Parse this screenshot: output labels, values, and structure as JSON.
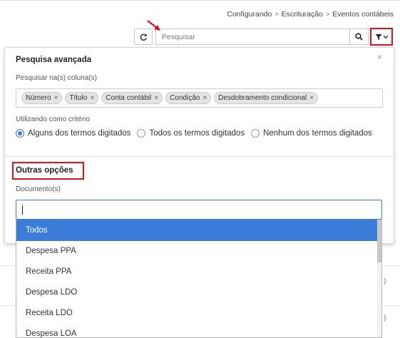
{
  "breadcrumb": [
    "Configurando",
    "Escrituração",
    "Eventos contábeis"
  ],
  "toolbar": {
    "search_placeholder": "Pesquisar"
  },
  "advanced_search": {
    "title": "Pesquisa avançada",
    "close_label": "×",
    "columns_label": "Pesquisar na(s) coluna(s)",
    "chips": [
      {
        "label": "Número"
      },
      {
        "label": "Título"
      },
      {
        "label": "Conta contábil"
      },
      {
        "label": "Condição"
      },
      {
        "label": "Desdobramento condicional"
      }
    ],
    "criteria_label": "Utilizando como critério",
    "criteria_options": [
      {
        "label": "Alguns dos termos digitados",
        "selected": true
      },
      {
        "label": "Todos os termos digitados",
        "selected": false
      },
      {
        "label": "Nenhum dos termos digitados",
        "selected": false
      }
    ],
    "other_options_title": "Outras opções",
    "documents_label": "Documento(s)",
    "documents_value": "",
    "documents_options": [
      "Todos",
      "Despesa PPA",
      "Receita PPA",
      "Despesa LDO",
      "Receita LDO",
      "Despesa LOA"
    ],
    "documents_selected": "Todos"
  },
  "colors": {
    "accent": "#3b7dd8",
    "annotation": "#e0101a"
  }
}
